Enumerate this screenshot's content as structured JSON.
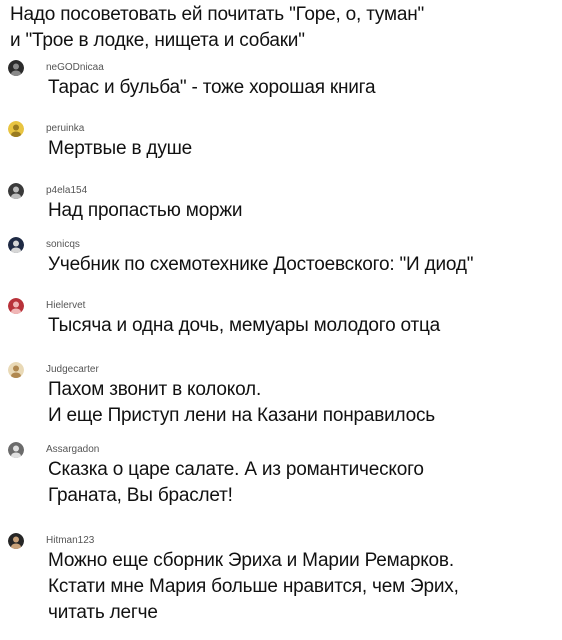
{
  "intro": {
    "line1": "Надо посоветовать ей почитать \"Горе, о, туман\"",
    "line2": "и \"Трое в лодке, нищета и собаки\""
  },
  "comments": [
    {
      "author": "neGODnicaa",
      "lines": [
        "Тарас и бульба\" - тоже хорошая книга"
      ],
      "avatar_icon": "user-avatar-dark"
    },
    {
      "author": "peruinka",
      "lines": [
        "Мертвые в душе"
      ],
      "avatar_icon": "user-avatar-yellow"
    },
    {
      "author": "p4ela154",
      "lines": [
        "Над пропастью моржи"
      ],
      "avatar_icon": "user-avatar-dark"
    },
    {
      "author": "sonicqs",
      "lines": [
        "Учебник по схемотехнике Достоевского: \"И диод\""
      ],
      "avatar_icon": "user-avatar-dark"
    },
    {
      "author": "Hielervet",
      "lines": [
        "Тысяча и одна дочь, мемуары молодого отца"
      ],
      "avatar_icon": "user-avatar-red"
    },
    {
      "author": "Judgecarter",
      "lines": [
        "Пахом звонит в колокол.",
        "И еще Приступ лени на Казани  понравилось"
      ],
      "avatar_icon": "user-avatar-tan"
    },
    {
      "author": "Assargadon",
      "lines": [
        "Сказка о царе салате. А из романтического",
        "Граната, Вы браслет!"
      ],
      "avatar_icon": "user-avatar-gray"
    },
    {
      "author": "Hitman123",
      "lines": [
        "Можно еще сборник Эриха и Марии Ремарков.",
        "Кстати мне Мария больше нравится, чем Эрих,",
        "читать легче"
      ],
      "avatar_icon": "user-avatar-dark"
    }
  ]
}
